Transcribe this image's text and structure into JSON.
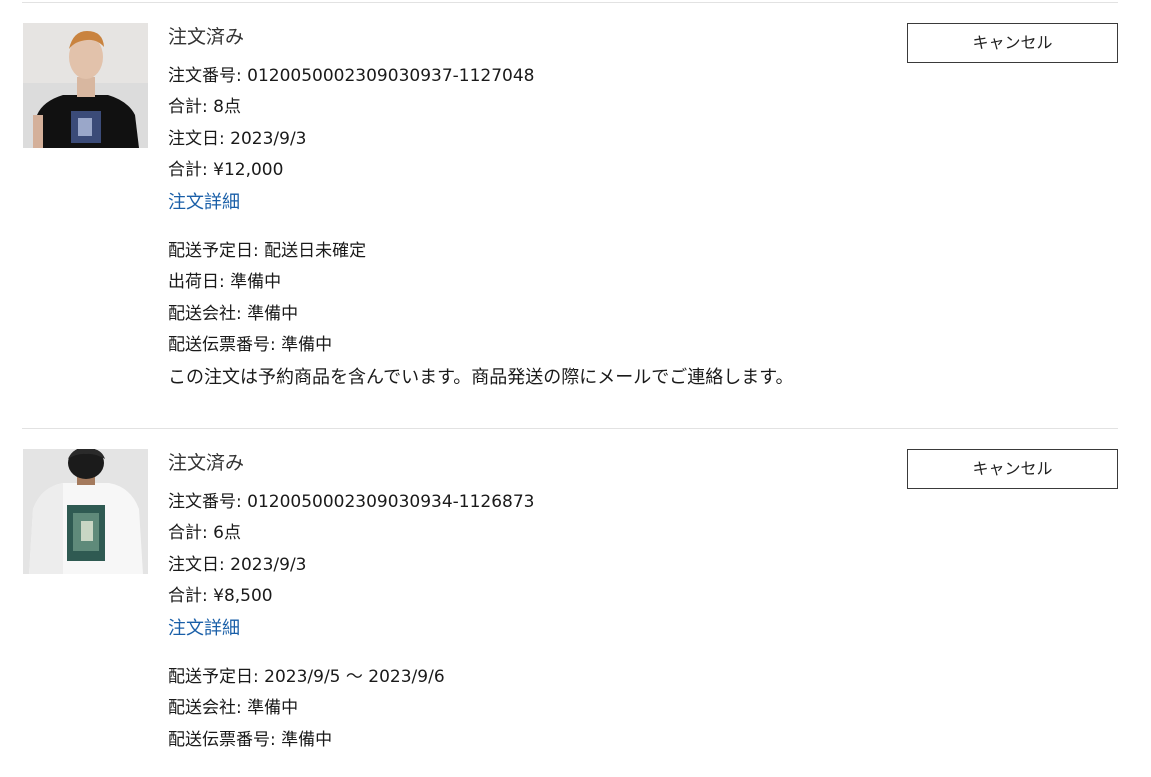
{
  "orders": [
    {
      "status": "注文済み",
      "order_number_label": "注文番号: ",
      "order_number": "0120050002309030937-1127048",
      "items_label": "合計: ",
      "items": "8点",
      "order_date_label": "注文日: ",
      "order_date": "2023/9/3",
      "total_label": "合計: ",
      "total": "¥12,000",
      "detail_link": "注文詳細",
      "delivery_date_label": "配送予定日: ",
      "delivery_date": "配送日未確定",
      "ship_date_label": "出荷日: ",
      "ship_date": "準備中",
      "carrier_label": "配送会社: ",
      "carrier": "準備中",
      "tracking_label": "配送伝票番号: ",
      "tracking": "準備中",
      "notice": "この注文は予約商品を含んでいます。商品発送の際にメールでご連絡します。",
      "cancel_label": "キャンセル",
      "thumbnail": "black-tshirt-model-front-photo"
    },
    {
      "status": "注文済み",
      "order_number_label": "注文番号: ",
      "order_number": "0120050002309030934-1126873",
      "items_label": "合計: ",
      "items": "6点",
      "order_date_label": "注文日: ",
      "order_date": "2023/9/3",
      "total_label": "合計: ",
      "total": "¥8,500",
      "detail_link": "注文詳細",
      "delivery_date_label": "配送予定日: ",
      "delivery_date": "2023/9/5 ～ 2023/9/6",
      "carrier_label": "配送会社: ",
      "carrier": "準備中",
      "tracking_label": "配送伝票番号: ",
      "tracking": "準備中",
      "cancel_label": "キャンセル",
      "thumbnail": "white-tshirt-model-back-photo"
    }
  ]
}
